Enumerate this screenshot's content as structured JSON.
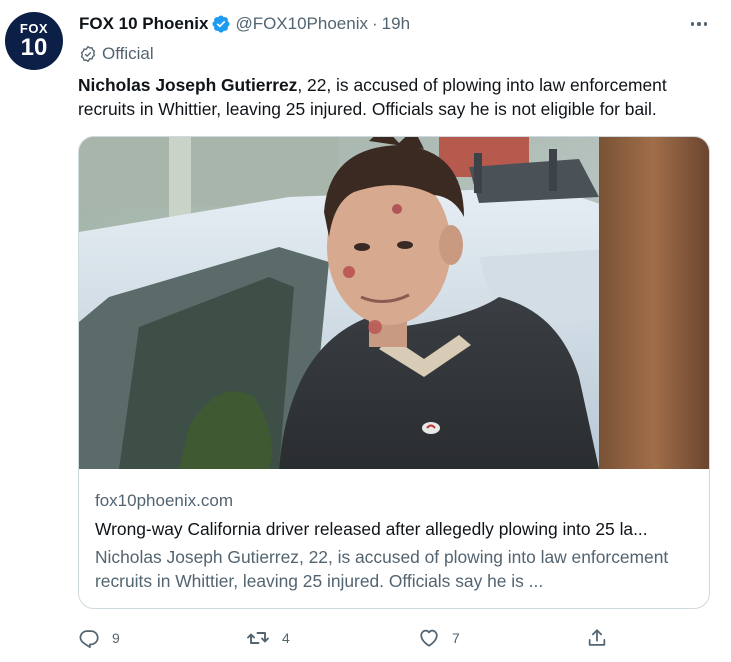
{
  "account": {
    "avatar_line1": "FOX",
    "avatar_line2": "10",
    "display_name": "FOX 10 Phoenix",
    "handle": "@FOX10Phoenix",
    "separator": "·",
    "time": "19h",
    "label": "Official",
    "verified_color": "#1d9bf0"
  },
  "tweet": {
    "text_bold": "Nicholas Joseph Gutierrez",
    "text_rest": ", 22, is accused of plowing into law enforcement recruits in Whittier, leaving 25 injured. Officials say he is not eligible for bail."
  },
  "card": {
    "domain": "fox10phoenix.com",
    "title": "Wrong-way California driver released after allegedly plowing into 25 la...",
    "description": "Nicholas Joseph Gutierrez, 22, is accused of plowing into law enforcement recruits in Whittier, leaving 25 injured. Officials say he is ...",
    "image_alt": "Photo of a young man in a dark hooded sweatshirt with facial injuries standing beside a white vehicle"
  },
  "actions": {
    "reply_count": "9",
    "retweet_count": "4",
    "like_count": "7",
    "icons": [
      "reply-icon",
      "retweet-icon",
      "like-icon",
      "share-icon"
    ]
  }
}
